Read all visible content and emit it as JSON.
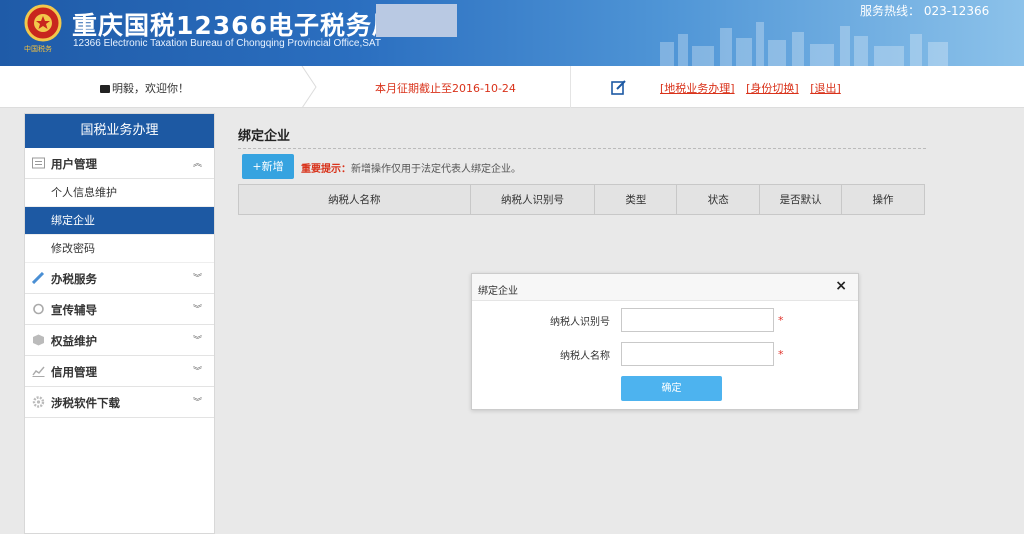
{
  "header": {
    "title": "重庆国税12366电子税务局",
    "subtitle": "12366 Electronic Taxation Bureau of Chongqing Provincial Office,SAT",
    "emblem_text": "中国税务",
    "hotline": "服务热线：  023-12366"
  },
  "infobar": {
    "welcome": "明毅，欢迎你！",
    "deadline": "本月征期截止至2016-10-24",
    "links": [
      "[地税业务办理]",
      "[身份切换]",
      "[退出]"
    ]
  },
  "sidebar": {
    "header": "国税业务办理",
    "group_user": "用户管理",
    "items": [
      "个人信息维护",
      "绑定企业",
      "修改密码"
    ],
    "groups": [
      {
        "label": "办税服务",
        "icon": "pencil-icon"
      },
      {
        "label": "宣传辅导",
        "icon": "refresh-icon"
      },
      {
        "label": "权益维护",
        "icon": "shield-icon"
      },
      {
        "label": "信用管理",
        "icon": "chart-icon"
      },
      {
        "label": "涉税软件下载",
        "icon": "gear-icon"
      }
    ]
  },
  "main": {
    "title": "绑定企业",
    "add_button": "+新增",
    "tip_label": "重要提示：",
    "tip_text": "新增操作仅用于法定代表人绑定企业。",
    "columns": [
      "纳税人名称",
      "纳税人识别号",
      "类型",
      "状态",
      "是否默认",
      "操作"
    ]
  },
  "modal": {
    "title": "绑定企业",
    "close": "×",
    "field1_label": "纳税人识别号",
    "field1_value": "",
    "field2_label": "纳税人名称",
    "field2_value": "",
    "required_mark": "*",
    "confirm": "确定"
  },
  "colors": {
    "brand_blue": "#1d59a3",
    "accent_blue": "#36a3e0",
    "alert_red": "#d9321a"
  }
}
